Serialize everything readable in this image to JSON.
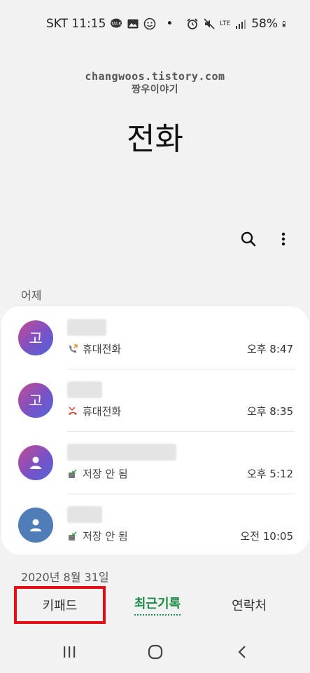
{
  "status_bar": {
    "carrier_time": "SKT 11:15",
    "dot": "•",
    "network": "LTE",
    "battery": "58%"
  },
  "watermark": {
    "line1": "changwoos.tistory.com",
    "line2": "짱우이야기"
  },
  "title": "전화",
  "sections": {
    "yesterday": "어제",
    "older_date": "2020년 8월 31일"
  },
  "calls": [
    {
      "avatar_text": "고",
      "type": "휴대전화",
      "time": "오후 8:47",
      "icon": "outgoing-call-icon"
    },
    {
      "avatar_text": "고",
      "type": "휴대전화",
      "time": "오후 8:35",
      "icon": "missed-call-icon"
    },
    {
      "avatar_text": "",
      "type": "저장 안 됨",
      "time": "오후 5:12",
      "icon": "incoming-call-icon"
    },
    {
      "avatar_text": "",
      "type": "저장 안 됨",
      "time": "오전 10:05",
      "icon": "incoming-call-icon"
    }
  ],
  "tabs": {
    "keypad": "키패드",
    "recents": "최근기록",
    "contacts": "연락처"
  },
  "colors": {
    "accent": "#1a8a46",
    "highlight": "#e51016"
  }
}
